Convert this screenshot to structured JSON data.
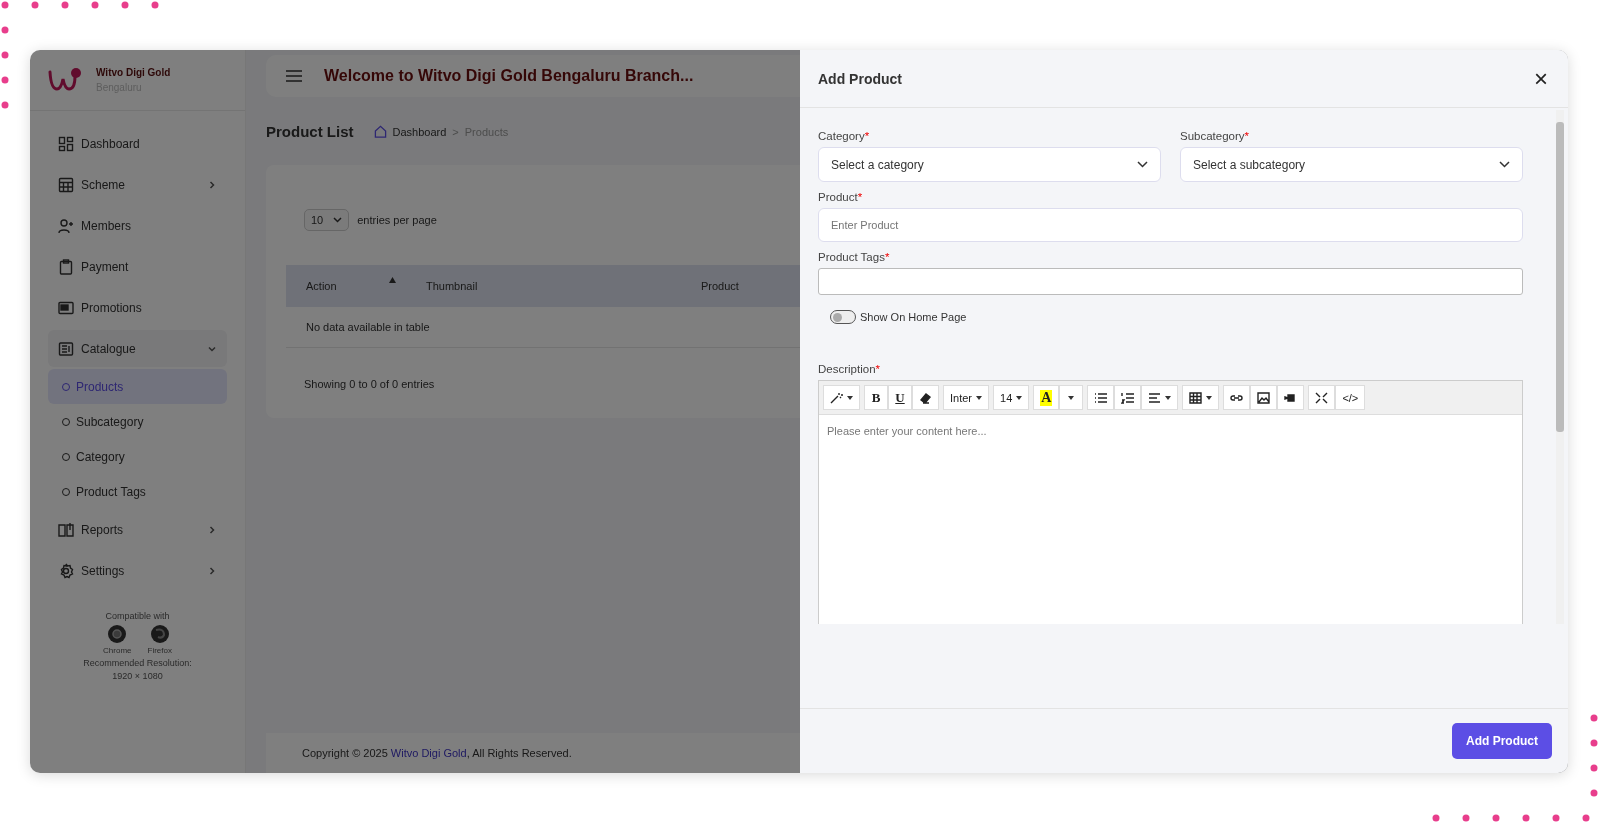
{
  "brand": {
    "name": "Witvo Digi Gold",
    "branch": "Bengaluru"
  },
  "sidebar": {
    "items": [
      {
        "label": "Dashboard",
        "kind": "link"
      },
      {
        "label": "Scheme",
        "kind": "group",
        "expanded": false
      },
      {
        "label": "Members",
        "kind": "link"
      },
      {
        "label": "Payment",
        "kind": "link"
      },
      {
        "label": "Promotions",
        "kind": "link"
      },
      {
        "label": "Catalogue",
        "kind": "group",
        "expanded": true,
        "children": [
          {
            "label": "Products",
            "selected": true
          },
          {
            "label": "Subcategory",
            "selected": false
          },
          {
            "label": "Category",
            "selected": false
          },
          {
            "label": "Product Tags",
            "selected": false
          }
        ]
      },
      {
        "label": "Reports",
        "kind": "group",
        "expanded": false
      },
      {
        "label": "Settings",
        "kind": "group",
        "expanded": false
      }
    ],
    "compat": {
      "heading": "Compatible with",
      "browsers": [
        "Chrome",
        "Firefox"
      ],
      "resolution_label": "Recommended Resolution:",
      "resolution": "1920 × 1080"
    }
  },
  "header": {
    "title": "Welcome to Witvo Digi Gold Bengaluru Branch..."
  },
  "page": {
    "title": "Product List",
    "breadcrumb": [
      {
        "label": "Dashboard",
        "kind": "home"
      },
      {
        "label": "Products",
        "kind": "current"
      }
    ],
    "separator": ">"
  },
  "table": {
    "page_size": "10",
    "page_size_label": "entries per page",
    "columns": [
      {
        "label": "Action",
        "sortable": true
      },
      {
        "label": "Thumbnail",
        "sortable": false
      },
      {
        "label": "Product",
        "sortable": false
      }
    ],
    "empty": "No data available in table",
    "info": "Showing 0 to 0 of 0 entries"
  },
  "footer": {
    "before": "Copyright © 2025 ",
    "link": "Witvo Digi Gold",
    "after": ", All Rights Reserved."
  },
  "drawer": {
    "title": "Add Product",
    "close": "×",
    "required_mark": "*",
    "selects": [
      {
        "label": "Category",
        "required": true,
        "placeholder": "Select a category"
      },
      {
        "label": "Subcategory",
        "required": true,
        "placeholder": "Select a subcategory"
      }
    ],
    "product": {
      "label": "Product",
      "required": true,
      "placeholder": "Enter Product"
    },
    "tags": {
      "label": "Product Tags",
      "required": true
    },
    "toggle": {
      "label": "Show On Home Page",
      "on": false
    },
    "description": {
      "label": "Description",
      "required": true,
      "placeholder": "Please enter your content here..."
    },
    "toolbar": [
      [
        {
          "kind": "wand",
          "caret": true
        }
      ],
      [
        {
          "kind": "bold",
          "text": "B"
        },
        {
          "kind": "underline",
          "text": "U"
        },
        {
          "kind": "eraser"
        }
      ],
      [
        {
          "kind": "font",
          "text": "Inter",
          "caret": true
        }
      ],
      [
        {
          "kind": "size",
          "text": "14",
          "caret": true
        }
      ],
      [
        {
          "kind": "color",
          "text": "A"
        },
        {
          "kind": "more",
          "caret": true
        }
      ],
      [
        {
          "kind": "ul"
        },
        {
          "kind": "ol"
        },
        {
          "kind": "align",
          "caret": true
        }
      ],
      [
        {
          "kind": "table",
          "caret": true
        }
      ],
      [
        {
          "kind": "link"
        },
        {
          "kind": "picture"
        },
        {
          "kind": "video"
        }
      ],
      [
        {
          "kind": "fullscreen"
        },
        {
          "kind": "code",
          "text": "</>"
        }
      ]
    ],
    "submit": "Add Product"
  }
}
